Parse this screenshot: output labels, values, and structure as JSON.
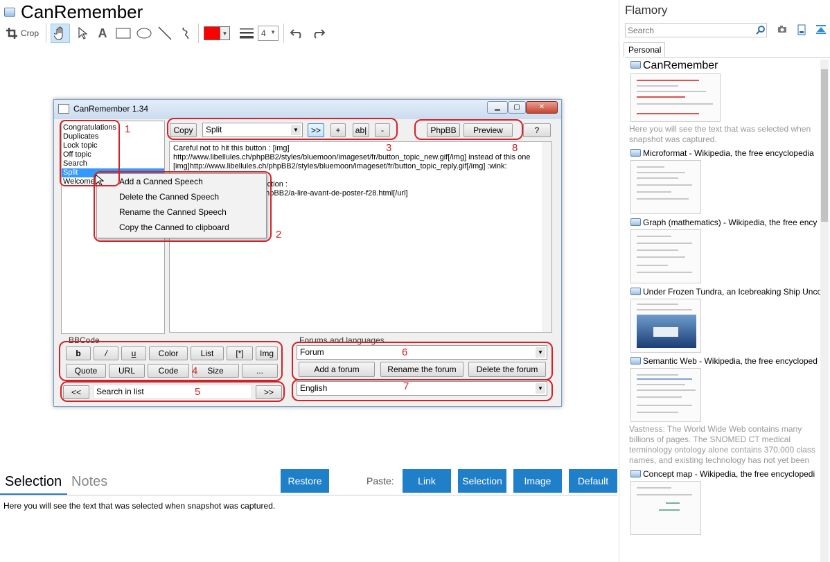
{
  "app": {
    "title": "CanRemember"
  },
  "toolbar": {
    "crop_label": "Crop",
    "line_width_value": "4",
    "color": "#ff0000"
  },
  "flamory": {
    "title": "Flamory",
    "search_placeholder": "Search",
    "tab_personal": "Personal",
    "snapshots": [
      {
        "title": "CanRemember",
        "description": "Here you will see the text that was selected when snapshot was captured."
      },
      {
        "title": "Microformat - Wikipedia, the free encyclopedia",
        "description": ""
      },
      {
        "title": "Graph (mathematics) - Wikipedia, the free ency",
        "description": ""
      },
      {
        "title": "Under Frozen Tundra, an Icebreaking Ship Unco",
        "description": ""
      },
      {
        "title": "Semantic Web - Wikipedia, the free encycloped",
        "description": "Vastness: The World Wide Web contains many billions of pages. The SNOMED CT medical terminology ontology alone contains 370,000 class names, and existing technology has not yet been able to eliminate all semantically duplicated terms. Any automated reasoning system will have to deal with truly huge inputs."
      },
      {
        "title": "Concept map - Wikipedia, the free encyclopedi",
        "description": ""
      }
    ]
  },
  "window": {
    "title": "CanRemember 1.34",
    "list_items": [
      "Congratulations",
      "Duplicates",
      "Lock topic",
      "Off topic",
      "Search",
      "Split",
      "Welcome"
    ],
    "selected_index": 5,
    "copy_label": "Copy",
    "combo_value": "Split",
    "btn_next": ">>",
    "btn_plus": "+",
    "btn_ab": "ab|",
    "btn_minus": "-",
    "btn_phpbb": "PhpBB",
    "btn_preview": "Preview",
    "btn_help": "?",
    "text_lines": [
      "Careful not to hit this button : [img]",
      "http://www.libellules.ch/phpBB2/styles/bluemoon/imageset/fr/button_topic_new.gif[/img] instead of this one",
      "[img]http://www.libellules.ch/phpBB2/styles/bluemoon/imageset/fr/button_topic_reply.gif[/img]  :wink:",
      "",
      "section :",
      "/phpBB2/a-lire-avant-de-poster-f28.html[/url]"
    ],
    "context_menu": [
      "Add a Canned Speech",
      "Delete the Canned Speech",
      "Rename the Canned Speech",
      "Copy the Canned to clipboard"
    ],
    "bbcode_group": "BBCode",
    "bbcode_row1": [
      "b",
      "/",
      "u",
      "Color",
      "List",
      "[*]",
      "Img"
    ],
    "bbcode_row2": [
      "Quote",
      "URL",
      "Code",
      "Size",
      "..."
    ],
    "search_prev": "<<",
    "search_value": "Search in list",
    "search_next": ">>",
    "forums_group": "Forums and languages",
    "forum_combo": "Forum",
    "btn_add_forum": "Add a forum",
    "btn_rename_forum": "Rename the forum",
    "btn_delete_forum": "Delete the forum",
    "language_combo": "English",
    "markers": [
      "1",
      "2",
      "3",
      "4",
      "5",
      "6",
      "7",
      "8"
    ]
  },
  "bottom": {
    "tab_selection": "Selection",
    "tab_notes": "Notes",
    "restore_label": "Restore",
    "paste_label": "Paste:",
    "paste_link": "Link",
    "paste_selection": "Selection",
    "paste_image": "Image",
    "paste_default": "Default",
    "selection_text": "Here you will see the text that was selected when snapshot was captured."
  },
  "colors": {
    "accent": "#1f7fc8",
    "annotation": "#d62026",
    "selection": "#3399ff"
  }
}
